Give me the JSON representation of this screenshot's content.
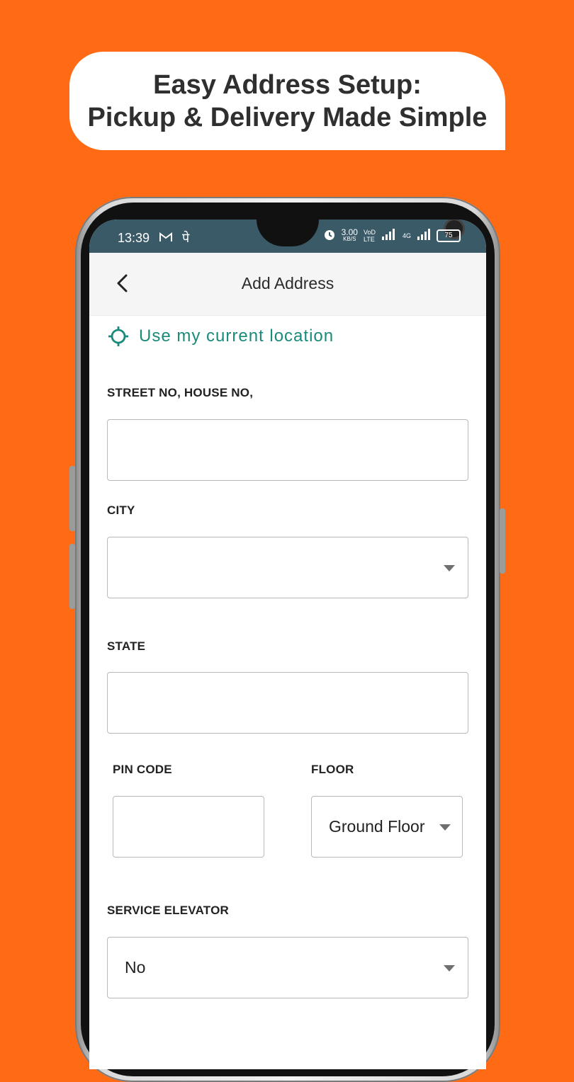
{
  "banner": {
    "line1": "Easy Address Setup:",
    "line2": "Pickup & Delivery Made Simple"
  },
  "statusbar": {
    "time": "13:39",
    "speed_top": "3.00",
    "speed_unit": "KB/S",
    "net_top": "VoD",
    "net_bottom": "LTE",
    "net2": "4G",
    "battery": "75"
  },
  "appbar": {
    "title": "Add Address"
  },
  "location": {
    "label": "Use my current location"
  },
  "form": {
    "street_label": "STREET NO, HOUSE NO,",
    "street_value": "",
    "city_label": "CITY",
    "city_value": "",
    "state_label": "STATE",
    "state_value": "",
    "pin_label": "PIN CODE",
    "pin_value": "",
    "floor_label": "FLOOR",
    "floor_value": "Ground Floor",
    "elevator_label": "SERVICE ELEVATOR",
    "elevator_value": "No"
  },
  "colors": {
    "background": "#FF6A14",
    "accent": "#1a8a7a",
    "statusbar": "#3a5a68"
  }
}
